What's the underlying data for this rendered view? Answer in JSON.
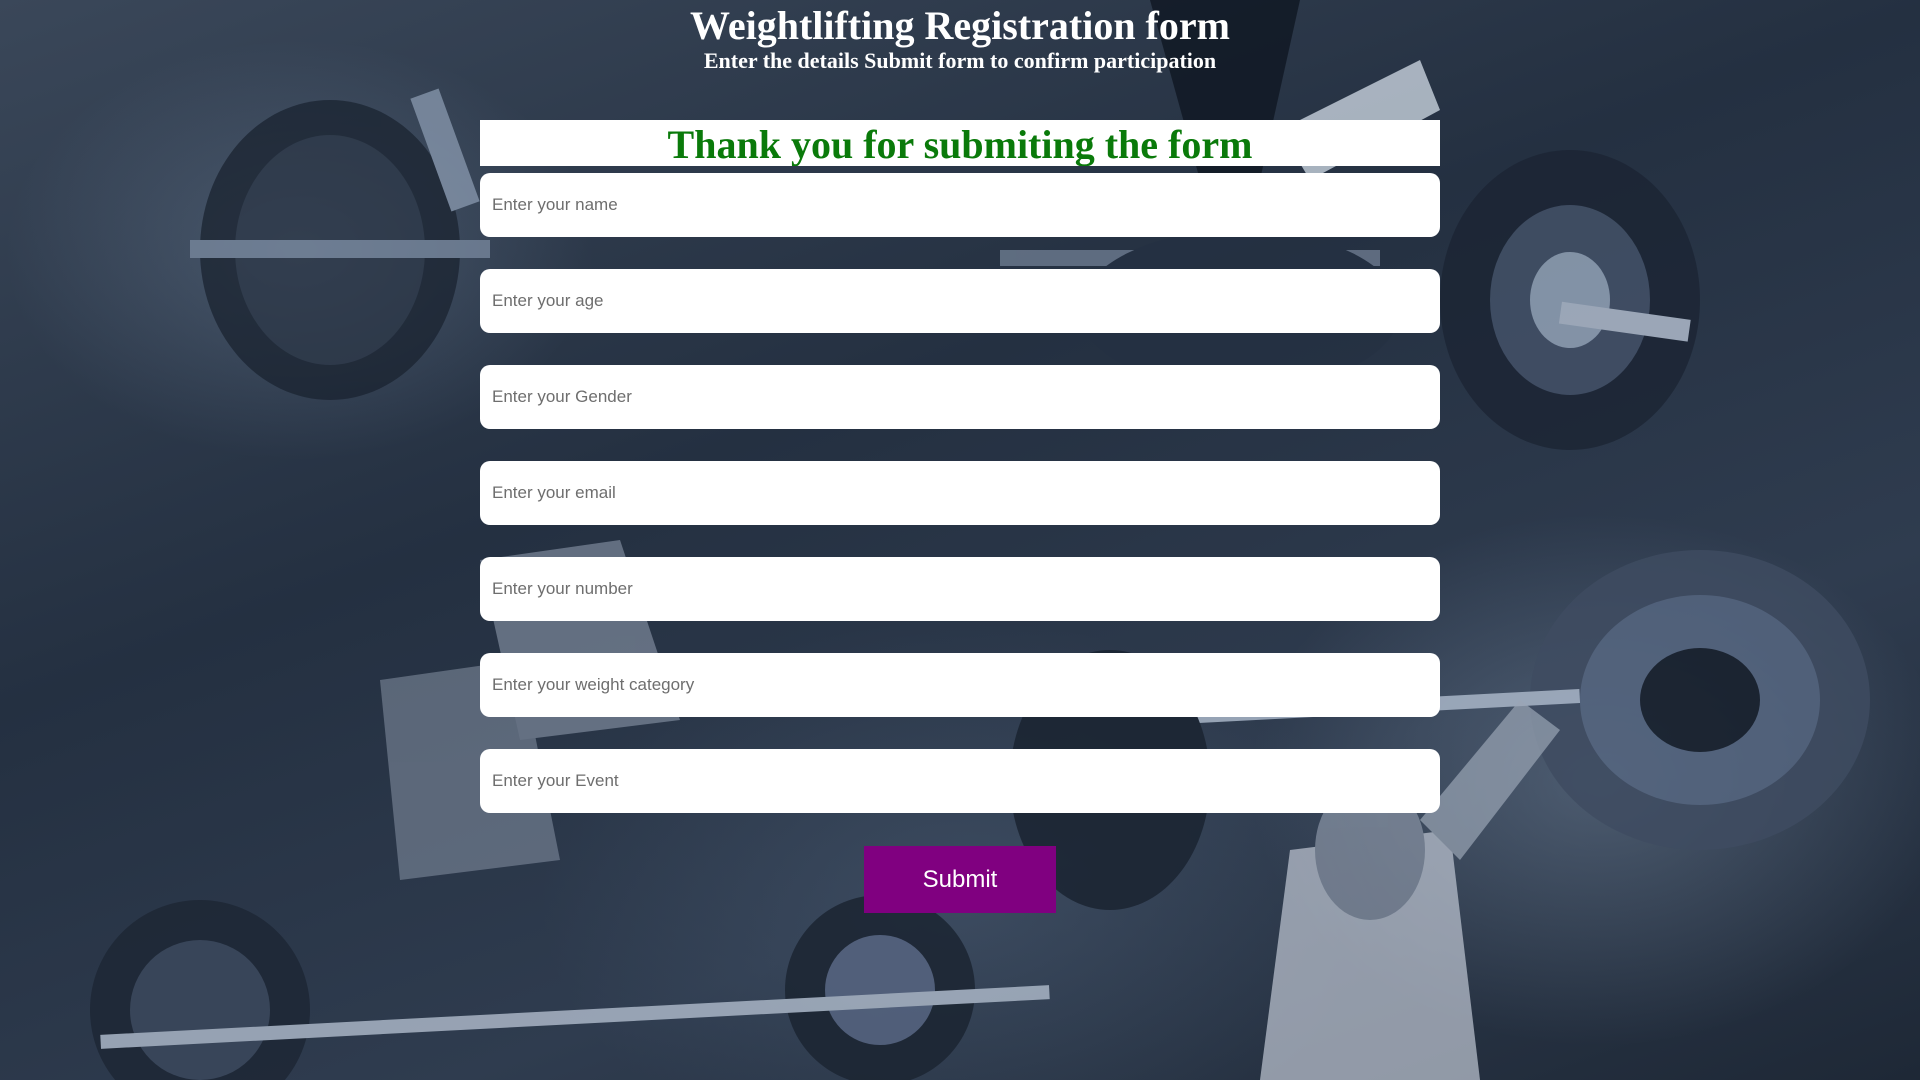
{
  "header": {
    "title": "Weightlifting Registration form",
    "subtitle": "Enter the details Submit form to confirm participation"
  },
  "form": {
    "success_message": "Thank you for submiting the form",
    "fields": [
      {
        "placeholder": "Enter your name",
        "value": ""
      },
      {
        "placeholder": "Enter your age",
        "value": ""
      },
      {
        "placeholder": "Enter your Gender",
        "value": ""
      },
      {
        "placeholder": "Enter your email",
        "value": ""
      },
      {
        "placeholder": "Enter your number",
        "value": ""
      },
      {
        "placeholder": "Enter your weight category",
        "value": ""
      },
      {
        "placeholder": "Enter your Event",
        "value": ""
      }
    ],
    "submit_label": "Submit"
  },
  "colors": {
    "success_text": "#0a7a0a",
    "submit_button": "#800080",
    "title_text": "#ffffff"
  }
}
